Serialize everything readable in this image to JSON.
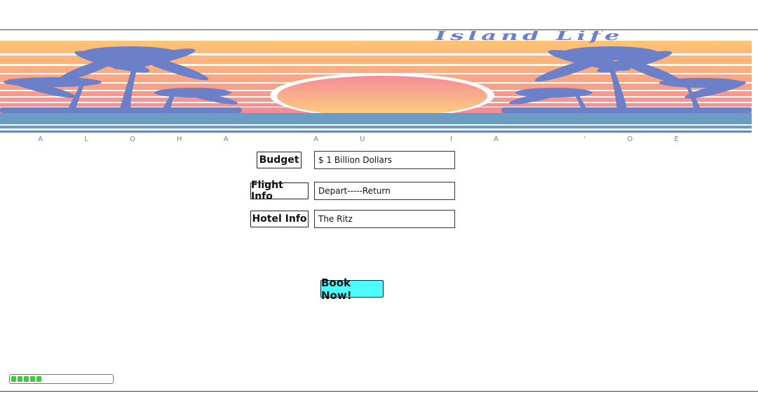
{
  "banner": {
    "title": "Island Life",
    "subtitle": "A L O H A   A U   I A   ' O E",
    "colors": {
      "sky_top": "#fdc472",
      "sky_bottom": "#f58b98",
      "palm": "#6c7fc9",
      "sea": "#6b9dc4",
      "sun_top": "#f58b98",
      "sun_bottom": "#fdd27e"
    }
  },
  "form": {
    "budget_label": "Budget",
    "budget_value": "$ 1 Billion Dollars",
    "flight_label": "Flight Info",
    "flight_value": "Depart-----Return",
    "hotel_label": "Hotel Info",
    "hotel_value": "The Ritz"
  },
  "actions": {
    "book_label": "Book Now!",
    "book_color": "#4dfcfc"
  },
  "progress": {
    "fraction": 0.35,
    "segments": 5,
    "color": "#3fca3f"
  }
}
